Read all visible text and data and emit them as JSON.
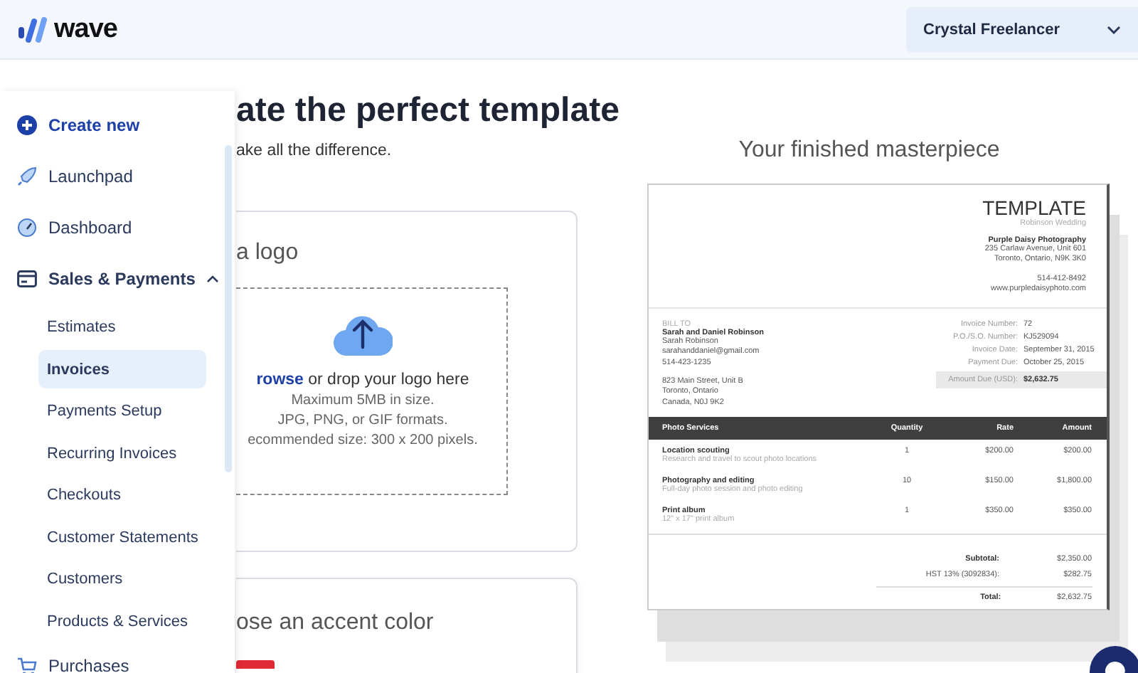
{
  "header": {
    "logo": "wave",
    "account": "Crystal Freelancer"
  },
  "sidebar": {
    "items": [
      {
        "kind": "action",
        "label": "Create new"
      },
      {
        "kind": "nav",
        "label": "Launchpad"
      },
      {
        "kind": "nav",
        "label": "Dashboard"
      },
      {
        "kind": "section",
        "label": "Sales & Payments",
        "expanded": true,
        "children": [
          {
            "label": "Estimates",
            "selected": false
          },
          {
            "label": "Invoices",
            "selected": true
          },
          {
            "label": "Payments Setup",
            "selected": false
          },
          {
            "label": "Recurring Invoices",
            "selected": false
          },
          {
            "label": "Checkouts",
            "selected": false
          },
          {
            "label": "Customer Statements",
            "selected": false
          },
          {
            "label": "Customers",
            "selected": false
          },
          {
            "label": "Products & Services",
            "selected": false
          }
        ]
      },
      {
        "kind": "nav",
        "label": "Purchases"
      }
    ]
  },
  "main": {
    "heading": "ate the perfect template",
    "subheading": "ake all the difference.",
    "logo_card": {
      "title": "a logo",
      "browse_link": "rowse",
      "drop_text": " or drop your logo here",
      "hints": [
        "Maximum 5MB in size.",
        "JPG, PNG, or GIF formats.",
        "ecommended size: 300 x 200 pixels."
      ]
    },
    "accent_card": {
      "title": "ose an accent color"
    }
  },
  "preview": {
    "title": "Your finished masterpiece",
    "invoice": {
      "title": "TEMPLATE",
      "subtitle": "Robinson Wedding",
      "company": "Purple Daisy Photography",
      "company_lines": [
        "235 Carlaw Avenue, Unit 601",
        "Toronto, Ontario, N9K 3K0"
      ],
      "contact_lines": [
        "514-412-8492",
        "www.purpledaisyphoto.com"
      ],
      "bill_to_label": "BILL TO",
      "customer": "Sarah and Daniel Robinson",
      "customer_lines": [
        "Sarah Robinson",
        "sarahanddaniel@gmail.com",
        "514-423-1235"
      ],
      "address_lines": [
        "823 Main Street, Unit B",
        "Toronto, Ontario",
        "Canada, N0J 9K2"
      ],
      "meta": [
        {
          "label": "Invoice Number:",
          "value": "72"
        },
        {
          "label": "P.O./S.O. Number:",
          "value": "KJ529094"
        },
        {
          "label": "Invoice Date:",
          "value": "September 31, 2015"
        },
        {
          "label": "Payment Due:",
          "value": "October 25, 2015"
        }
      ],
      "amount_due": {
        "label": "Amount Due (USD):",
        "value": "$2,632.75"
      },
      "columns": [
        "Photo Services",
        "Quantity",
        "Rate",
        "Amount"
      ],
      "rows": [
        {
          "item": "Location scouting",
          "description": "Research and travel to scout photo locations",
          "quantity": "1",
          "rate": "$200.00",
          "amount": "$200.00"
        },
        {
          "item": "Photography and editing",
          "description": "Full-day photo session and photo editing",
          "quantity": "10",
          "rate": "$150.00",
          "amount": "$1,800.00"
        },
        {
          "item": "Print album",
          "description": "12\" x 17\" print album",
          "quantity": "1",
          "rate": "$350.00",
          "amount": "$350.00"
        }
      ],
      "totals": [
        {
          "label": "Subtotal:",
          "value": "$2,350.00"
        },
        {
          "label": "HST 13% (3092834):",
          "value": "$282.75"
        }
      ],
      "total": {
        "label": "Total:",
        "value": "$2,632.75"
      }
    }
  }
}
